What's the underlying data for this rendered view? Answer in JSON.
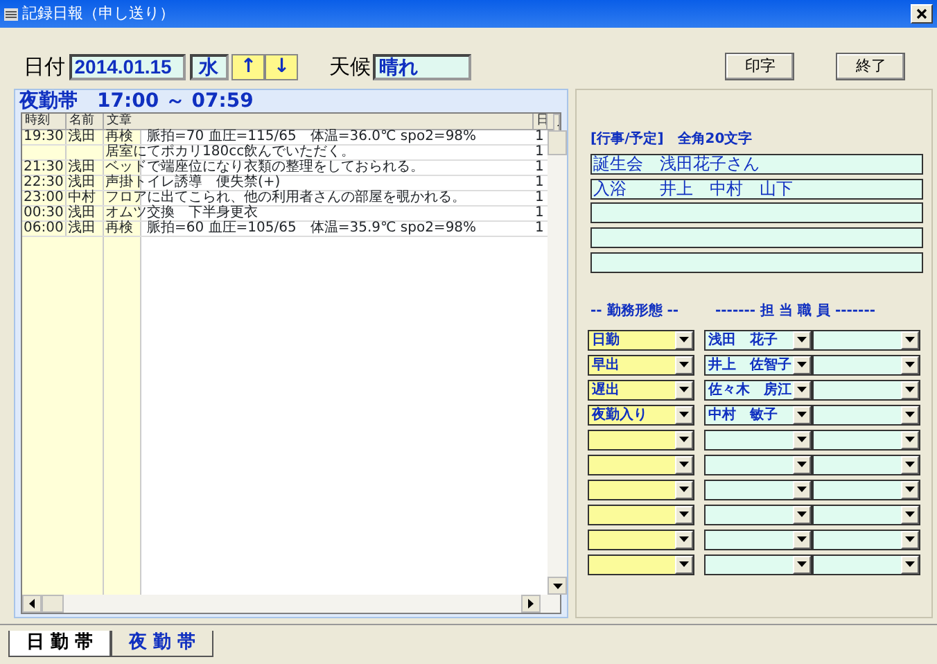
{
  "window": {
    "title": "記録日報（申し送り）"
  },
  "header": {
    "date_label": "日付",
    "date": "2014.01.15",
    "weekday": "水",
    "up_button": "↑",
    "down_button": "↓",
    "weather_label": "天候",
    "weather": "晴れ",
    "print_button": "印字",
    "close_button": "終了"
  },
  "shift_panel": {
    "heading": "夜勤帯　17:00 ～ 07:59",
    "table": {
      "columns": [
        "時刻",
        "名前",
        "文章",
        "日"
      ],
      "rows": [
        {
          "time": "19:30",
          "name": "浅田",
          "text": "再検　脈拍=70 血圧=115/65　体温=36.0℃ spo2=98%",
          "column_4": "1"
        },
        {
          "text": "居室にてポカリ180cc飲んでいただく。",
          "column_4": "1"
        },
        {
          "time": "21:30",
          "name": "浅田",
          "text": "ベッドで端座位になり衣類の整理をしておられる。",
          "column_4": "1"
        },
        {
          "time": "22:30",
          "name": "浅田",
          "text": "声掛トイレ誘導　便失禁(+)",
          "column_4": "1"
        },
        {
          "time": "23:00",
          "name": "中村",
          "text": "フロアに出てこられ、他の利用者さんの部屋を覗かれる。",
          "column_4": "1"
        },
        {
          "time": "00:30",
          "name": "浅田",
          "text": "オムツ交換　下半身更衣",
          "column_4": "1"
        },
        {
          "time": "06:00",
          "name": "浅田",
          "text": "再検　脈拍=60 血圧=105/65　体温=35.9℃ spo2=98%",
          "column_4": "1"
        }
      ]
    }
  },
  "side_panel": {
    "events_label": "[行事/予定]　全角20文字",
    "events": [
      {
        "kind": "filled",
        "value": "誕生会　浅田花子さん"
      },
      {
        "kind": "filled",
        "value": "入浴　　井上　中村　山下"
      },
      {
        "kind": "blank"
      },
      {
        "kind": "blank"
      },
      {
        "kind": "blank"
      }
    ],
    "shift_type_label": "-- 勤務形態 --",
    "staff_label": "------- 担 当 職 員 -------",
    "assignments": [
      {
        "kind": "filled",
        "shift_type": "日勤",
        "staff_1": "浅田　花子"
      },
      {
        "kind": "filled",
        "shift_type": "早出",
        "staff_1": "井上　佐智子"
      },
      {
        "kind": "filled",
        "shift_type": "遅出",
        "staff_1": "佐々木　房江"
      },
      {
        "kind": "filled",
        "shift_type": "夜勤入り",
        "staff_1": "中村　敏子"
      },
      {
        "kind": "blank"
      },
      {
        "kind": "blank"
      },
      {
        "kind": "blank"
      },
      {
        "kind": "blank"
      },
      {
        "kind": "blank"
      },
      {
        "kind": "blank"
      }
    ]
  },
  "tabs": [
    {
      "label": "日 勤 帯",
      "selected": false
    },
    {
      "label": "夜 勤 帯",
      "selected": true
    }
  ]
}
